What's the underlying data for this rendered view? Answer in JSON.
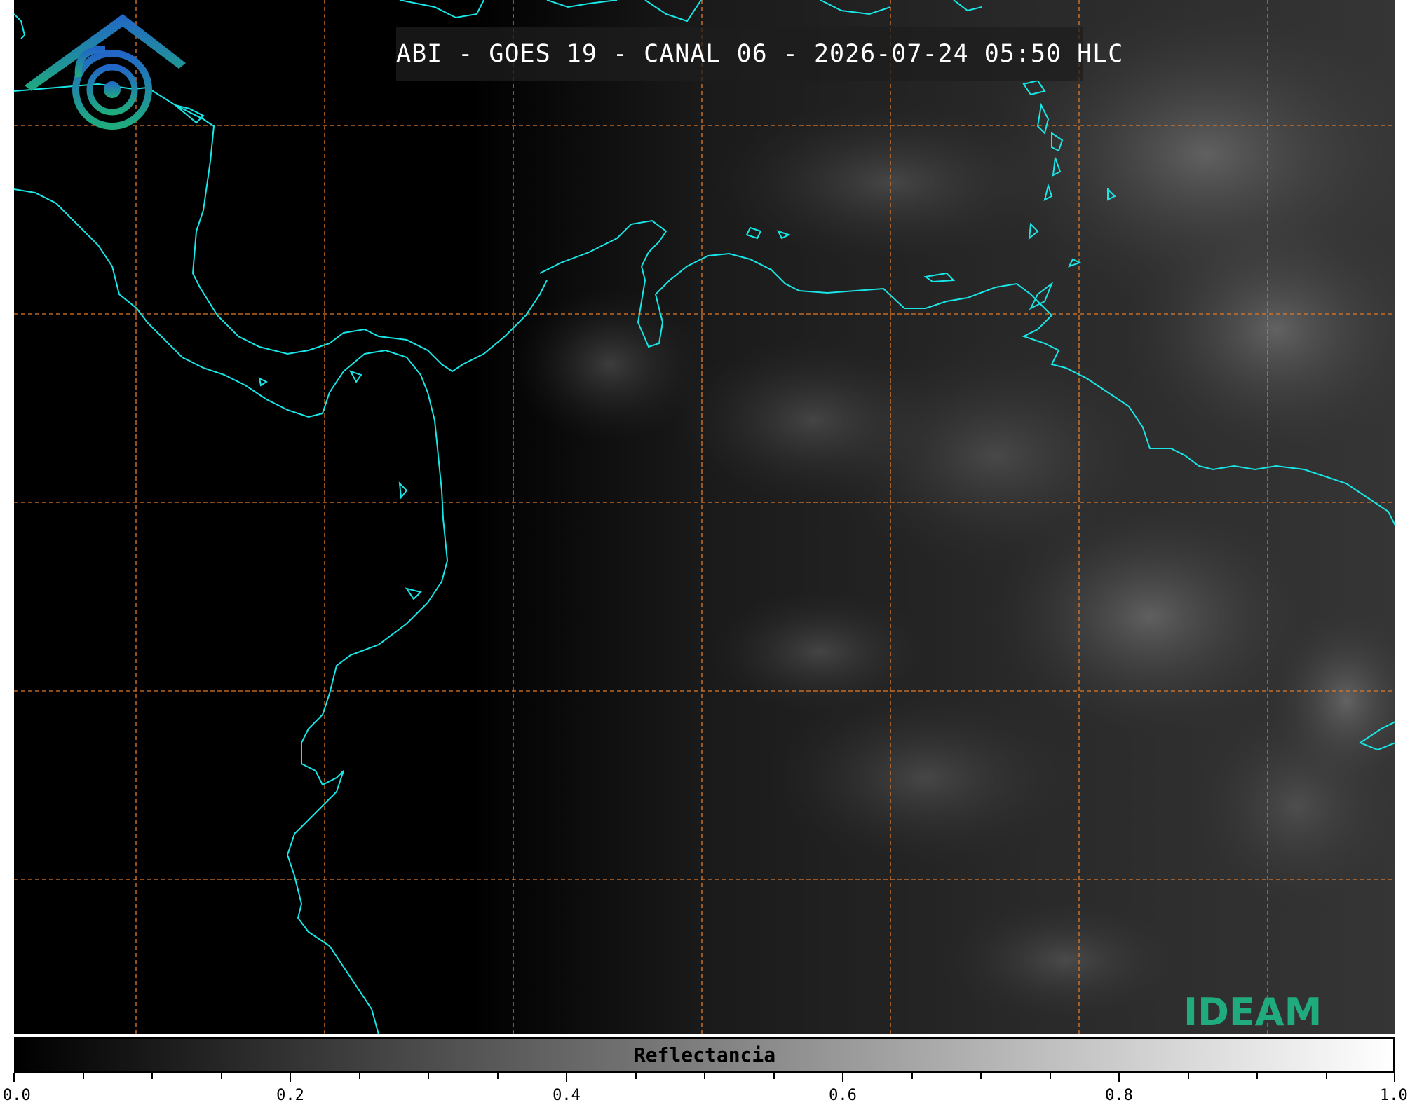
{
  "title": "ABI - GOES 19 - CANAL 06 - 2026-07-24 05:50 HLC",
  "colorbar": {
    "label": "Reflectancia",
    "range": [
      0.0,
      1.0
    ],
    "colors": [
      "#000000",
      "#ffffff"
    ],
    "major_ticks": [
      {
        "value": 0.0,
        "label": "0.0"
      },
      {
        "value": 0.2,
        "label": "0.2"
      },
      {
        "value": 0.4,
        "label": "0.4"
      },
      {
        "value": 0.6,
        "label": "0.6"
      },
      {
        "value": 0.8,
        "label": "0.8"
      },
      {
        "value": 1.0,
        "label": "1.0"
      }
    ],
    "minor_step": 0.05
  },
  "logo": {
    "text": "IDEAM",
    "name": "ideam-logo"
  },
  "colors": {
    "coastline": "#19e6e6",
    "gridlines": "#e07a2a",
    "title_text": "#ffffff",
    "logo_green": "#1fab7e",
    "logo_blue": "#2266c8"
  },
  "map": {
    "gridlines": "dashed",
    "gridline_columns": 7,
    "gridline_rows": 5
  }
}
